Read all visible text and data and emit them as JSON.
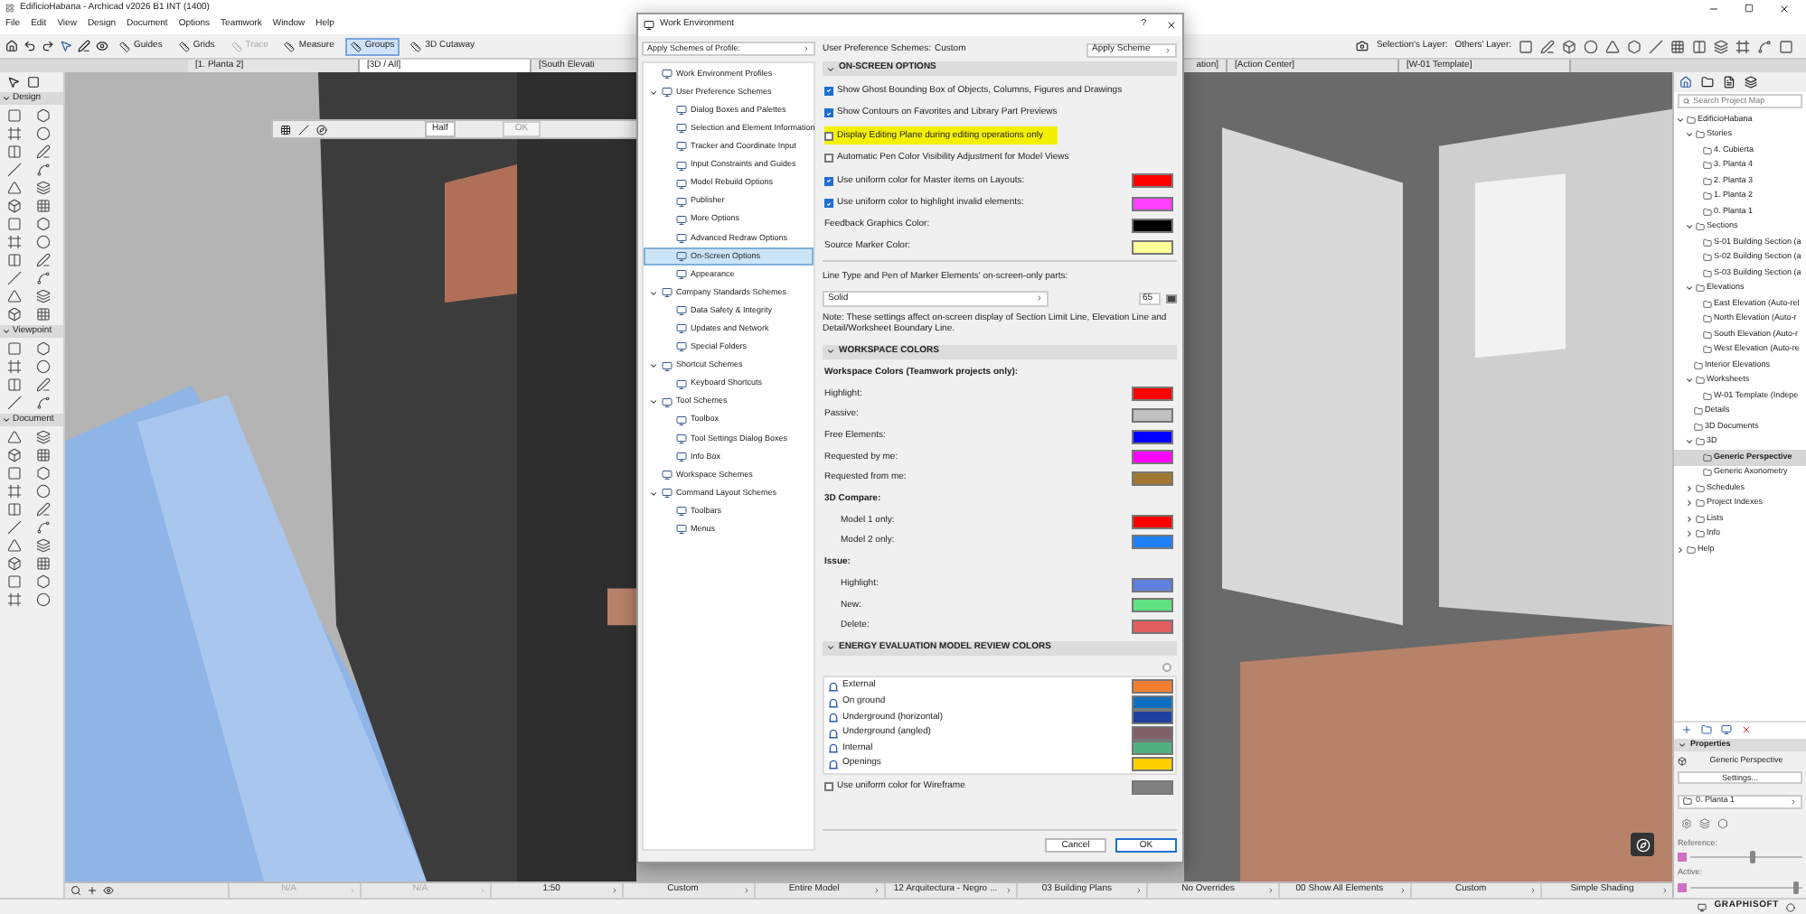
{
  "app": {
    "title": "EdificioHabana - Archicad v2026 B1 INT (1400)"
  },
  "menu": [
    "File",
    "Edit",
    "View",
    "Design",
    "Document",
    "Options",
    "Teamwork",
    "Window",
    "Help"
  ],
  "toolbar": {
    "buttons": [
      {
        "label": "Guides",
        "disabled": false,
        "selected": false
      },
      {
        "label": "Grids",
        "disabled": false,
        "selected": false
      },
      {
        "label": "Trace",
        "disabled": true,
        "selected": false
      },
      {
        "label": "Measure",
        "disabled": false,
        "selected": false
      },
      {
        "label": "Groups",
        "disabled": false,
        "selected": true
      },
      {
        "label": "3D Cutaway",
        "disabled": false,
        "selected": false
      }
    ],
    "layer_labels": [
      "Selection's Layer:",
      "Others' Layer:"
    ]
  },
  "view_tabs": [
    {
      "label": "[1. Planta 2]",
      "selected": false
    },
    {
      "label": "[3D / All]",
      "selected": true
    },
    {
      "label": "[South Elevati",
      "selected": false
    },
    {
      "label": "ation]",
      "selected": false
    },
    {
      "label": "[Action Center]",
      "selected": false
    },
    {
      "label": "[W-01 Template]",
      "selected": false
    }
  ],
  "toolbox": {
    "sections": [
      {
        "title": "Design",
        "expanded": true
      },
      {
        "title": "Viewpoint",
        "expanded": true
      },
      {
        "title": "Document",
        "expanded": true
      }
    ]
  },
  "info_box": {
    "value": "Half",
    "button": "OK"
  },
  "dialog": {
    "title": "Work Environment",
    "help": "?",
    "profile_dropdown": "Apply Schemes of Profile:",
    "tree": [
      {
        "label": "Work Environment Profiles",
        "selected": false
      },
      {
        "label": "User Preference Schemes",
        "selected": false,
        "expanded": true,
        "children": [
          {
            "label": "Dialog Boxes and Palettes",
            "selected": false
          },
          {
            "label": "Selection and Element Information",
            "selected": false
          },
          {
            "label": "Tracker and Coordinate Input",
            "selected": false
          },
          {
            "label": "Input Constraints and Guides",
            "selected": false
          },
          {
            "label": "Model Rebuild Options",
            "selected": false
          },
          {
            "label": "Publisher",
            "selected": false
          },
          {
            "label": "More Options",
            "selected": false
          },
          {
            "label": "Advanced Redraw Options",
            "selected": false
          },
          {
            "label": "On-Screen Options",
            "selected": true
          },
          {
            "label": "Appearance",
            "selected": false
          }
        ]
      },
      {
        "label": "Company Standards Schemes",
        "selected": false,
        "expanded": true,
        "children": [
          {
            "label": "Data Safety & Integrity",
            "selected": false
          },
          {
            "label": "Updates and Network",
            "selected": false
          },
          {
            "label": "Special Folders",
            "selected": false
          }
        ]
      },
      {
        "label": "Shortcut Schemes",
        "selected": false,
        "expanded": true,
        "children": [
          {
            "label": "Keyboard Shortcuts",
            "selected": false
          }
        ]
      },
      {
        "label": "Tool Schemes",
        "selected": false,
        "expanded": true,
        "children": [
          {
            "label": "Toolbox",
            "selected": false
          },
          {
            "label": "Tool Settings Dialog Boxes",
            "selected": false
          },
          {
            "label": "Info Box",
            "selected": false
          }
        ]
      },
      {
        "label": "Workspace Schemes",
        "selected": false
      },
      {
        "label": "Command Layout Schemes",
        "selected": false,
        "expanded": true,
        "children": [
          {
            "label": "Toolbars",
            "selected": false
          },
          {
            "label": "Menus",
            "selected": false
          }
        ]
      }
    ],
    "scheme_label": "User Preference Schemes:",
    "scheme_value": "Custom",
    "apply_button": "Apply Scheme",
    "sections": [
      {
        "title": "ON-SCREEN OPTIONS",
        "expanded": true,
        "items": [
          {
            "kind": "check",
            "label": "Show Ghost Bounding Box of Objects, Columns, Figures and Drawings",
            "checked": true,
            "highlighted": false
          },
          {
            "kind": "check",
            "label": "Show Contours on Favorites and Library Part Previews",
            "checked": true,
            "highlighted": false
          },
          {
            "kind": "check",
            "label": "Display Editing Plane during editing operations only",
            "checked": false,
            "highlighted": true
          },
          {
            "kind": "check",
            "label": "Automatic Pen Color Visibility Adjustment for Model Views",
            "checked": false,
            "highlighted": false
          },
          {
            "kind": "check",
            "label": "Use uniform color for Master items on Layouts:",
            "checked": true,
            "highlighted": false,
            "color": "#ff0000"
          },
          {
            "kind": "check",
            "label": "Use uniform color to highlight invalid elements:",
            "checked": true,
            "highlighted": false,
            "color": "#ff40ff"
          },
          {
            "kind": "color",
            "label": "Feedback Graphics Color:",
            "color": "#000000"
          },
          {
            "kind": "color",
            "label": "Source Marker Color:",
            "color": "#ffff99"
          }
        ],
        "marker_line": {
          "label": "Line Type and Pen of Marker Elements' on-screen-only parts:",
          "line_type": "Solid",
          "pen": "65",
          "note": "Note: These settings affect on-screen display of Section Limit Line, Elevation Line and Detail/Worksheet Boundary Line."
        }
      },
      {
        "title": "WORKSPACE COLORS",
        "expanded": true,
        "items": [
          {
            "kind": "heading",
            "label": "Workspace Colors (Teamwork projects only):"
          },
          {
            "kind": "color",
            "label": "Highlight:",
            "color": "#ff0000"
          },
          {
            "kind": "color",
            "label": "Passive:",
            "color": "#c0c0c0"
          },
          {
            "kind": "color",
            "label": "Free Elements:",
            "color": "#0000ff"
          },
          {
            "kind": "color",
            "label": "Requested by me:",
            "color": "#ff00ff"
          },
          {
            "kind": "color",
            "label": "Requested from me:",
            "color": "#a07830"
          },
          {
            "kind": "heading",
            "label": "3D Compare:",
            "children": [
              {
                "kind": "color",
                "label": "Model 1 only:",
                "color": "#ff0000"
              },
              {
                "kind": "color",
                "label": "Model 2 only:",
                "color": "#2080ff"
              }
            ]
          },
          {
            "kind": "heading",
            "label": "Issue:",
            "children": [
              {
                "kind": "color",
                "label": "Highlight:",
                "color": "#6080e0"
              },
              {
                "kind": "color",
                "label": "New:",
                "color": "#60e080"
              },
              {
                "kind": "color",
                "label": "Delete:",
                "color": "#e06060"
              }
            ]
          }
        ]
      },
      {
        "title": "ENERGY EVALUATION MODEL REVIEW COLORS",
        "expanded": true,
        "list": [
          {
            "label": "External",
            "color": "#f08030"
          },
          {
            "label": "On ground",
            "color": "#1070c0"
          },
          {
            "label": "Underground (horizontal)",
            "color": "#2040a0"
          },
          {
            "label": "Underground (angled)",
            "color": "#806068"
          },
          {
            "label": "Internal",
            "color": "#50b080"
          },
          {
            "label": "Openings",
            "color": "#ffd000"
          }
        ],
        "items": [
          {
            "kind": "check",
            "label": "Use uniform color for Wireframe",
            "checked": false,
            "highlighted": false,
            "color": "#808080"
          }
        ]
      }
    ],
    "buttons": [
      {
        "label": "Cancel",
        "default": false
      },
      {
        "label": "OK",
        "default": true
      }
    ]
  },
  "navigator": {
    "search": {
      "placeholder": "Search Project Map"
    },
    "tree": [
      {
        "label": "EdificioHabana",
        "expanded": true,
        "selected": false,
        "children": [
          {
            "label": "Stories",
            "expanded": true,
            "selected": false,
            "children": [
              {
                "label": "4. Cubierta",
                "selected": false
              },
              {
                "label": "3. Planta 4",
                "selected": false
              },
              {
                "label": "2. Planta 3",
                "selected": false
              },
              {
                "label": "1. Planta 2",
                "selected": false
              },
              {
                "label": "0. Planta 1",
                "selected": false
              }
            ]
          },
          {
            "label": "Sections",
            "expanded": true,
            "selected": false,
            "children": [
              {
                "label": "S-01 Building Section (a",
                "selected": false
              },
              {
                "label": "S-02 Building Section (a",
                "selected": false
              },
              {
                "label": "S-03 Building Section (a",
                "selected": false
              }
            ]
          },
          {
            "label": "Elevations",
            "expanded": true,
            "selected": false,
            "children": [
              {
                "label": "East Elevation (Auto-rel",
                "selected": false
              },
              {
                "label": "North Elevation (Auto-r",
                "selected": false
              },
              {
                "label": "South Elevation (Auto-r",
                "selected": false
              },
              {
                "label": "West Elevation (Auto-re",
                "selected": false
              }
            ]
          },
          {
            "label": "Interior Elevations",
            "selected": false
          },
          {
            "label": "Worksheets",
            "expanded": true,
            "selected": false,
            "children": [
              {
                "label": "W-01 Template (Indepe",
                "selected": false
              }
            ]
          },
          {
            "label": "Details",
            "selected": false
          },
          {
            "label": "3D Documents",
            "selected": false
          },
          {
            "label": "3D",
            "expanded": true,
            "selected": false,
            "children": [
              {
                "label": "Generic Perspective",
                "selected": true
              },
              {
                "label": "Generic Axonometry",
                "selected": false
              }
            ]
          },
          {
            "label": "Schedules",
            "expanded": false,
            "selected": false
          },
          {
            "label": "Project Indexes",
            "expanded": false,
            "selected": false
          },
          {
            "label": "Lists",
            "expanded": false,
            "selected": false
          },
          {
            "label": "Info",
            "expanded": false,
            "selected": false
          }
        ]
      },
      {
        "label": "Help",
        "expanded": false,
        "selected": false
      }
    ],
    "properties": {
      "title": "Properties",
      "expanded": true,
      "view_name": "Generic Perspective",
      "settings_button": "Settings...",
      "story": "0. Planta 1",
      "sliders": [
        {
          "label": "Reference:",
          "level": 0.55
        },
        {
          "label": "Active:",
          "level": 0.95
        }
      ]
    }
  },
  "status_bar": {
    "fields": [
      {
        "label": "N/A",
        "disabled": true
      },
      {
        "label": "N/A",
        "disabled": true
      },
      {
        "label": "1:50",
        "disabled": false
      },
      {
        "label": "Custom",
        "disabled": false
      },
      {
        "label": "Entire Model",
        "disabled": false
      },
      {
        "label": "12 Arquitectura - Negro ...",
        "disabled": false
      },
      {
        "label": "03 Building Plans",
        "disabled": false
      },
      {
        "label": "No Overrides",
        "disabled": false
      },
      {
        "label": "00 Show All Elements",
        "disabled": false
      },
      {
        "label": "Custom",
        "disabled": false
      },
      {
        "label": "Simple Shading",
        "disabled": false
      }
    ]
  },
  "footer": {
    "brand": "GRAPHISOFT"
  }
}
